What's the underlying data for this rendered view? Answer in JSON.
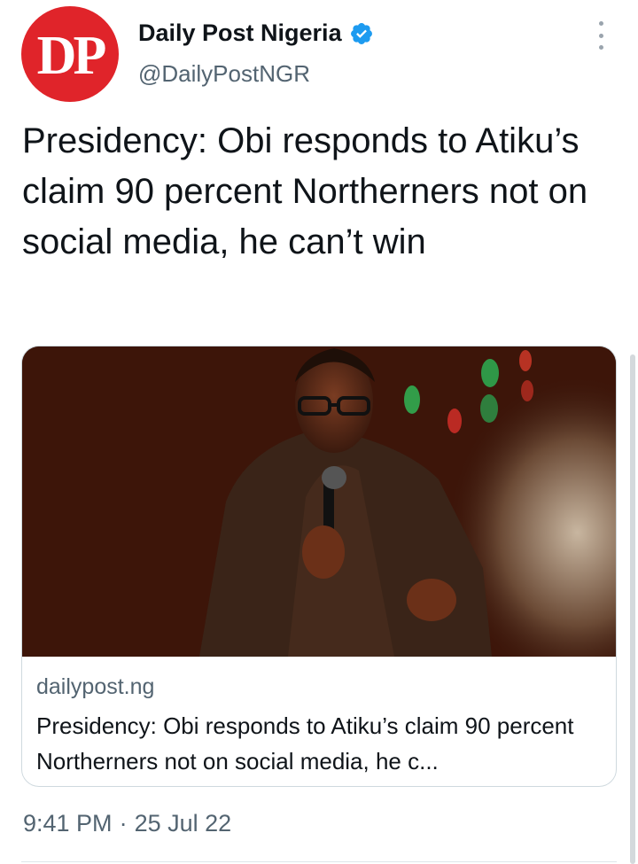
{
  "author": {
    "avatar_text": "DP",
    "display_name": "Daily Post Nigeria",
    "handle": "@DailyPostNGR",
    "verified": true
  },
  "tweet": {
    "text": "Presidency: Obi responds to Atiku’s claim 90 percent Northerners not on social media, he can’t win"
  },
  "link_card": {
    "domain": "dailypost.ng",
    "title": "Presidency: Obi responds to Atiku’s claim 90 percent Northerners not on social media, he c..."
  },
  "meta": {
    "time": "9:41 PM",
    "separator": "·",
    "date": "25 Jul 22"
  },
  "colors": {
    "avatar_bg": "#e0242a",
    "verified_blue": "#1d9bf0",
    "secondary_text": "#536471"
  }
}
